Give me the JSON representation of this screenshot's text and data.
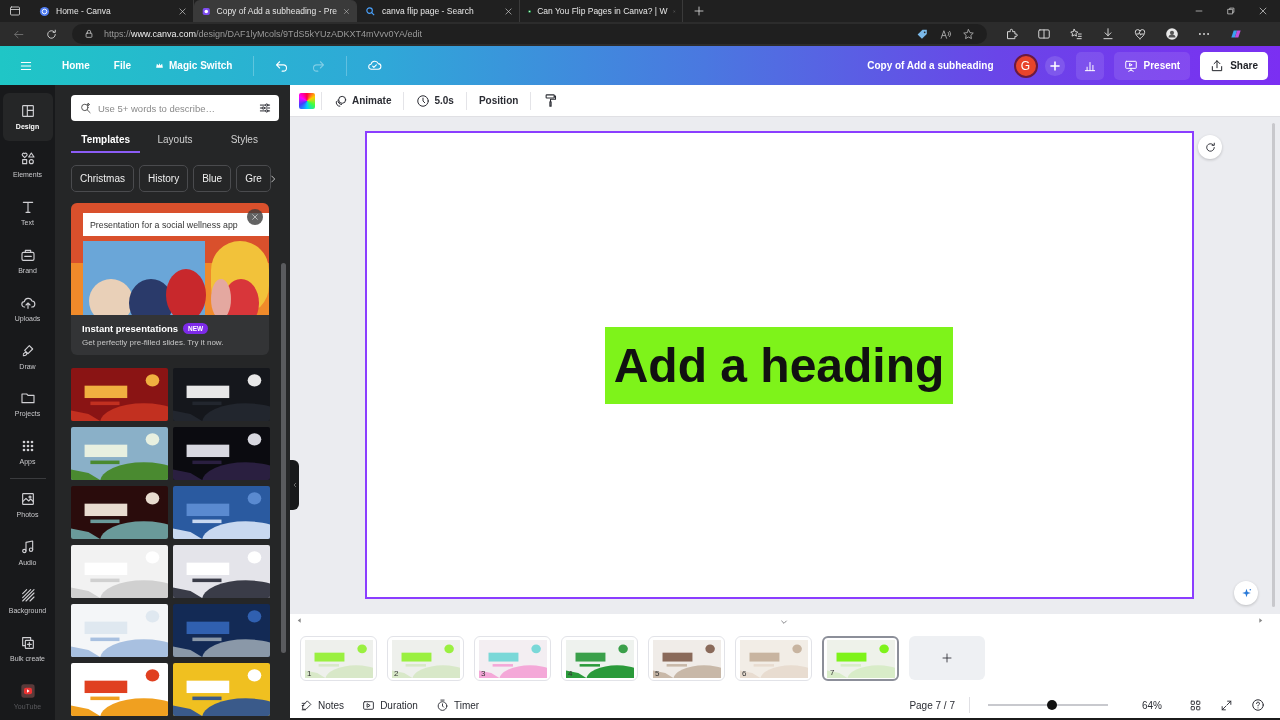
{
  "browser": {
    "tabs": [
      {
        "title": "Home - Canva",
        "selected": false,
        "kind": "canva"
      },
      {
        "title": "Copy of Add a subheading - Pre",
        "selected": true,
        "kind": "document"
      },
      {
        "title": "canva flip page - Search",
        "selected": false,
        "kind": "search"
      },
      {
        "title": "Can You Flip Pages in Canva? | W",
        "selected": false,
        "kind": "site"
      }
    ],
    "url": {
      "scheme": "https://",
      "host": "www.canva.com",
      "path": "/design/DAF1lyMcols/9TdS5kYUzADKXT4mVvv0YA/edit"
    }
  },
  "header": {
    "nav": [
      {
        "label": "Home",
        "kind": "plain"
      },
      {
        "label": "File",
        "kind": "plain"
      },
      {
        "label": "Magic Switch",
        "kind": "premium"
      }
    ],
    "doc_title": "Copy of Add a subheading",
    "avatar": "G",
    "present": "Present",
    "share": "Share"
  },
  "rail": {
    "groups": [
      [
        {
          "label": "Design",
          "selected": true,
          "disabled": false
        },
        {
          "label": "Elements",
          "selected": false,
          "disabled": false
        },
        {
          "label": "Text",
          "selected": false,
          "disabled": false
        },
        {
          "label": "Brand",
          "selected": false,
          "disabled": false
        },
        {
          "label": "Uploads",
          "selected": false,
          "disabled": false
        },
        {
          "label": "Draw",
          "selected": false,
          "disabled": false
        },
        {
          "label": "Projects",
          "selected": false,
          "disabled": false
        },
        {
          "label": "Apps",
          "selected": false,
          "disabled": false
        }
      ],
      [
        {
          "label": "Photos",
          "selected": false,
          "disabled": false
        },
        {
          "label": "Audio",
          "selected": false,
          "disabled": false
        },
        {
          "label": "Background",
          "selected": false,
          "disabled": false
        },
        {
          "label": "Bulk create",
          "selected": false,
          "disabled": false
        },
        {
          "label": "YouTube",
          "selected": false,
          "disabled": true
        }
      ]
    ]
  },
  "panel": {
    "search": {
      "placeholder": "Use 5+ words to describe…"
    },
    "tabs": [
      {
        "label": "Templates",
        "selected": true
      },
      {
        "label": "Layouts",
        "selected": false
      },
      {
        "label": "Styles",
        "selected": false
      }
    ],
    "chips": [
      "Christmas",
      "History",
      "Blue",
      "Gre"
    ],
    "promo": {
      "prompt": "Presentation for a social wellness app",
      "title": "Instant presentations",
      "badge": "NEW",
      "text": "Get perfectly pre-filled slides. Try it now."
    },
    "templates": [
      {
        "kind": "picture"
      },
      {
        "kind": "picture"
      },
      {
        "kind": "picture"
      },
      {
        "kind": "picture"
      },
      {
        "kind": "picture"
      },
      {
        "kind": "picture"
      },
      {
        "kind": "picture"
      },
      {
        "kind": "picture"
      },
      {
        "kind": "picture"
      },
      {
        "kind": "picture"
      },
      {
        "kind": "picture"
      },
      {
        "kind": "picture"
      }
    ]
  },
  "toolbar": {
    "items": [
      {
        "kind": "color"
      },
      {
        "kind": "animate",
        "label": "Animate"
      },
      {
        "kind": "duration",
        "label": "5.0s"
      },
      {
        "kind": "position",
        "label": "Position"
      },
      {
        "kind": "paint"
      }
    ]
  },
  "slide": {
    "heading": "Add a heading"
  },
  "pages": [
    {
      "number": "1",
      "selected": false
    },
    {
      "number": "2",
      "selected": false
    },
    {
      "number": "3",
      "selected": false
    },
    {
      "number": "4",
      "selected": false
    },
    {
      "number": "5",
      "selected": false
    },
    {
      "number": "6",
      "selected": false
    },
    {
      "number": "7",
      "selected": true
    }
  ],
  "footer": {
    "notes": "Notes",
    "duration": "Duration",
    "timer": "Timer",
    "page": "Page 7 / 7",
    "zoom": {
      "level": 0.53,
      "reading": "64%"
    }
  }
}
